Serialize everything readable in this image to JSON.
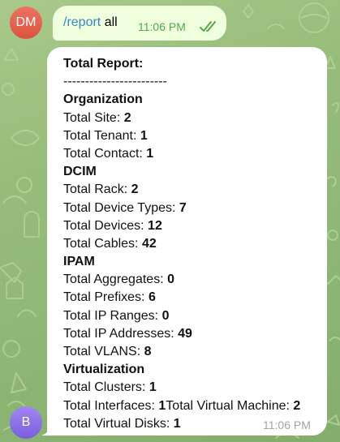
{
  "chat": {
    "avatar_dm": {
      "initials": "DM",
      "color": "#e5654f"
    },
    "avatar_b": {
      "initials": "B",
      "color": "#8a70e8"
    },
    "command_message": {
      "command": "/report",
      "argument": " all",
      "time": "11:06 PM",
      "status_icon": "double-check-icon"
    },
    "report_message": {
      "title": "Total Report:",
      "divider": "------------------------",
      "organization": {
        "heading": "Organization",
        "site_label": "Total Site: ",
        "site_value": "2",
        "tenant_label": "Total Tenant: ",
        "tenant_value": "1",
        "contact_label": "Total Contact: ",
        "contact_value": "1"
      },
      "dcim": {
        "heading": "DCIM",
        "rack_label": "Total Rack: ",
        "rack_value": "2",
        "device_types_label": "Total Device Types: ",
        "device_types_value": "7",
        "devices_label": "Total Devices: ",
        "devices_value": "12",
        "cables_label": "Total Cables: ",
        "cables_value": "42"
      },
      "ipam": {
        "heading": "IPAM",
        "aggregates_label": "Total Aggregates: ",
        "aggregates_value": "0",
        "prefixes_label": "Total Prefixes: ",
        "prefixes_value": "6",
        "ip_ranges_label": "Total IP Ranges: ",
        "ip_ranges_value": "0",
        "ip_addresses_label": "Total IP Addresses: ",
        "ip_addresses_value": "49",
        "vlans_label": "Total VLANS: ",
        "vlans_value": "8"
      },
      "virtualization": {
        "heading": "Virtualization",
        "clusters_label": "Total Clusters: ",
        "clusters_value": "1",
        "interfaces_label": "Total Interfaces: ",
        "interfaces_value": "1",
        "virtual_machine_label": "Total Virtual Machine: ",
        "virtual_machine_value": "2",
        "virtual_disks_label": "Total Virtual Disks: ",
        "virtual_disks_value": "1"
      },
      "time": "11:06 PM"
    }
  },
  "colors": {
    "background_top": "#a9c98a",
    "background_bottom": "#84ad6c",
    "outgoing_bubble": "#effedd",
    "incoming_bubble": "#ffffff",
    "link": "#3a86c8",
    "outgoing_time": "#55a84e",
    "incoming_time": "#a3a3a3"
  }
}
